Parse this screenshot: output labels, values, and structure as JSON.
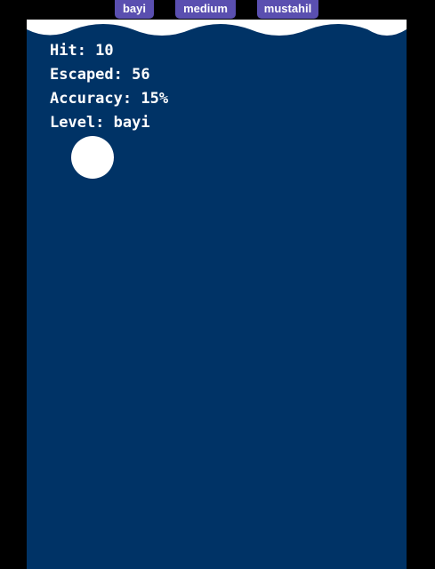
{
  "levels": {
    "buttons": [
      {
        "label": "bayi"
      },
      {
        "label": "medium"
      },
      {
        "label": "mustahil"
      }
    ],
    "button_color": "#5a4fb0"
  },
  "game": {
    "background_color": "#003366",
    "wave_color": "#ffffff",
    "ball_color": "#ffffff"
  },
  "stats": {
    "hit": "Hit: 10",
    "escaped": "Escaped: 56",
    "accuracy": "Accuracy: 15%",
    "level": "Level: bayi"
  }
}
